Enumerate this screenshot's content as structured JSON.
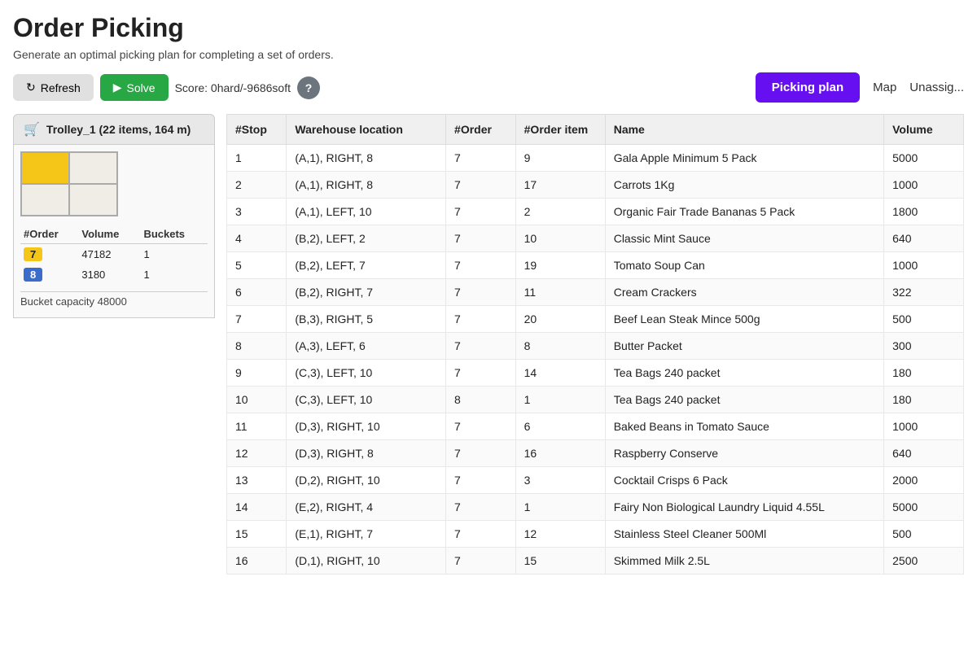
{
  "page": {
    "title": "Order Picking",
    "subtitle": "Generate an optimal picking plan for completing a set of orders."
  },
  "toolbar": {
    "refresh_label": "Refresh",
    "solve_label": "Solve",
    "score_text": "Score: 0hard/-9686soft",
    "help_label": "?",
    "picking_plan_label": "Picking plan",
    "map_label": "Map",
    "unassign_label": "Unassig..."
  },
  "sidebar": {
    "trolley_header": "Trolley_1  (22 items, 164 m)",
    "bucket_capacity_label": "Bucket capacity 48000",
    "orders_table": {
      "headers": [
        "#Order",
        "Volume",
        "Buckets"
      ],
      "rows": [
        {
          "order": "7",
          "color": "yellow",
          "volume": "47182",
          "buckets": "1"
        },
        {
          "order": "8",
          "color": "blue",
          "volume": "3180",
          "buckets": "1"
        }
      ]
    }
  },
  "table": {
    "headers": [
      "#Stop",
      "Warehouse location",
      "#Order",
      "#Order item",
      "Name",
      "Volume"
    ],
    "rows": [
      {
        "stop": "1",
        "location": "(A,1), RIGHT, 8",
        "order": "7",
        "order_item": "9",
        "name": "Gala Apple Minimum 5 Pack",
        "volume": "5000"
      },
      {
        "stop": "2",
        "location": "(A,1), RIGHT, 8",
        "order": "7",
        "order_item": "17",
        "name": "Carrots 1Kg",
        "volume": "1000"
      },
      {
        "stop": "3",
        "location": "(A,1), LEFT, 10",
        "order": "7",
        "order_item": "2",
        "name": "Organic Fair Trade Bananas 5 Pack",
        "volume": "1800"
      },
      {
        "stop": "4",
        "location": "(B,2), LEFT, 2",
        "order": "7",
        "order_item": "10",
        "name": "Classic Mint Sauce",
        "volume": "640"
      },
      {
        "stop": "5",
        "location": "(B,2), LEFT, 7",
        "order": "7",
        "order_item": "19",
        "name": "Tomato Soup Can",
        "volume": "1000"
      },
      {
        "stop": "6",
        "location": "(B,2), RIGHT, 7",
        "order": "7",
        "order_item": "11",
        "name": "Cream Crackers",
        "volume": "322"
      },
      {
        "stop": "7",
        "location": "(B,3), RIGHT, 5",
        "order": "7",
        "order_item": "20",
        "name": "Beef Lean Steak Mince 500g",
        "volume": "500"
      },
      {
        "stop": "8",
        "location": "(A,3), LEFT, 6",
        "order": "7",
        "order_item": "8",
        "name": "Butter Packet",
        "volume": "300"
      },
      {
        "stop": "9",
        "location": "(C,3), LEFT, 10",
        "order": "7",
        "order_item": "14",
        "name": "Tea Bags 240 packet",
        "volume": "180"
      },
      {
        "stop": "10",
        "location": "(C,3), LEFT, 10",
        "order": "8",
        "order_item": "1",
        "name": "Tea Bags 240 packet",
        "volume": "180"
      },
      {
        "stop": "11",
        "location": "(D,3), RIGHT, 10",
        "order": "7",
        "order_item": "6",
        "name": "Baked Beans in Tomato Sauce",
        "volume": "1000"
      },
      {
        "stop": "12",
        "location": "(D,3), RIGHT, 8",
        "order": "7",
        "order_item": "16",
        "name": "Raspberry Conserve",
        "volume": "640"
      },
      {
        "stop": "13",
        "location": "(D,2), RIGHT, 10",
        "order": "7",
        "order_item": "3",
        "name": "Cocktail Crisps 6 Pack",
        "volume": "2000"
      },
      {
        "stop": "14",
        "location": "(E,2), RIGHT, 4",
        "order": "7",
        "order_item": "1",
        "name": "Fairy Non Biological Laundry Liquid 4.55L",
        "volume": "5000"
      },
      {
        "stop": "15",
        "location": "(E,1), RIGHT, 7",
        "order": "7",
        "order_item": "12",
        "name": "Stainless Steel Cleaner 500Ml",
        "volume": "500"
      },
      {
        "stop": "16",
        "location": "(D,1), RIGHT, 10",
        "order": "7",
        "order_item": "15",
        "name": "Skimmed Milk 2.5L",
        "volume": "2500"
      }
    ]
  }
}
